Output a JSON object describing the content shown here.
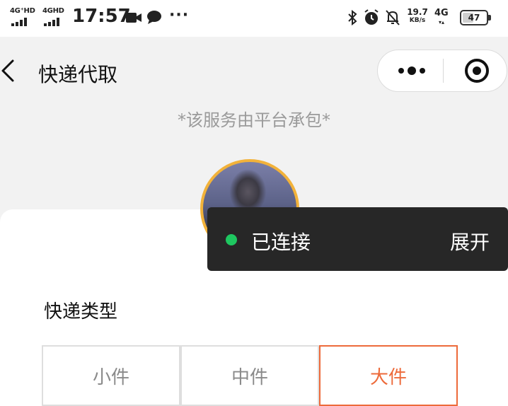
{
  "status_bar": {
    "signal1_label": "4G⁺HD",
    "signal2_label": "4GHD",
    "time": "17:57",
    "net_speed_value": "19.7",
    "net_speed_unit": "KB/s",
    "network_type": "4G",
    "network_arrows": "▾▴",
    "battery_level": 47,
    "battery_text": "47"
  },
  "nav": {
    "title": "快递代取"
  },
  "notice": "*该服务由平台承包*",
  "form": {
    "section_label": "快递类型",
    "options": [
      {
        "label": "小件",
        "selected": false
      },
      {
        "label": "中件",
        "selected": false
      },
      {
        "label": "大件",
        "selected": true
      }
    ]
  },
  "toast": {
    "status": "已连接",
    "status_color": "#1ec760",
    "action": "展开"
  },
  "colors": {
    "accent": "#ed6a3a",
    "avatar_border": "#f2b23a"
  }
}
